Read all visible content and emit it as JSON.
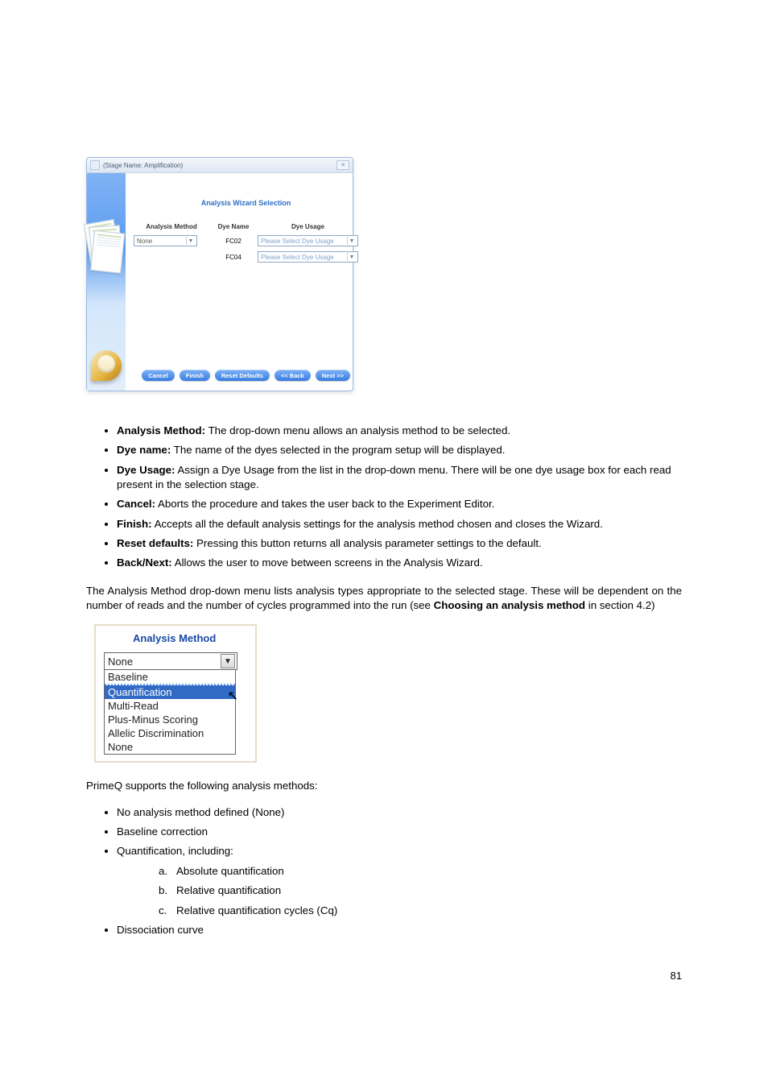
{
  "dialog": {
    "window_title": "(Stage Name: Amplification)",
    "close_symbol": "✕",
    "wizard_title": "Analysis Wizard Selection",
    "headers": {
      "method": "Analysis Method",
      "dye_name": "Dye Name",
      "dye_usage": "Dye Usage"
    },
    "method_value": "None",
    "dye_rows": [
      {
        "name": "FC02",
        "usage": "Please Select Dye Usage"
      },
      {
        "name": "FC04",
        "usage": "Please Select Dye Usage"
      }
    ],
    "buttons": {
      "cancel": "Cancel",
      "finish": "Finish",
      "reset": "Reset Defaults",
      "back": "<< Back",
      "next": "Next >>"
    }
  },
  "bullets": [
    {
      "term": "Analysis Method:",
      "body": "The drop-down menu allows an analysis method to be selected."
    },
    {
      "term": "Dye name:",
      "body": "The name of the dyes selected in the program setup will be displayed."
    },
    {
      "term": "Dye Usage:",
      "body": "Assign a Dye Usage from the list in the drop-down menu. There will be one dye usage box for each read present in the selection stage."
    },
    {
      "term": "Cancel:",
      "body": "Aborts the procedure and takes the user back to the Experiment Editor."
    },
    {
      "term": "Finish:",
      "body": "Accepts all the default analysis settings for the analysis method chosen and closes the Wizard."
    },
    {
      "term": "Reset defaults:",
      "body": "Pressing this button returns all analysis parameter settings to the default."
    },
    {
      "term": "Back/Next:",
      "body": "Allows the user to move between screens in the Analysis Wizard."
    }
  ],
  "para1_a": "The Analysis Method drop-down menu lists analysis types appropriate to the selected stage. These will be dependent on the number of reads and the number of cycles programmed into the run (see ",
  "para1_bold": "Choosing an analysis method",
  "para1_b": " in section 4.2)",
  "dropdown_image": {
    "heading": "Analysis Method",
    "selected": "None",
    "items": [
      "Baseline",
      "Quantification",
      "Multi-Read",
      "Plus-Minus Scoring",
      "Allelic Discrimination",
      "None"
    ],
    "highlighted": "Quantification"
  },
  "para2": "PrimeQ supports the following analysis methods:",
  "methods": [
    "No analysis method defined (None)",
    "Baseline correction",
    "Quantification, including:",
    "Dissociation curve"
  ],
  "sub_methods": [
    {
      "letter": "a.",
      "text": "Absolute quantification"
    },
    {
      "letter": "b.",
      "text": "Relative quantification"
    },
    {
      "letter": "c.",
      "text": "Relative quantification cycles (Cq)"
    }
  ],
  "page_number": "81"
}
